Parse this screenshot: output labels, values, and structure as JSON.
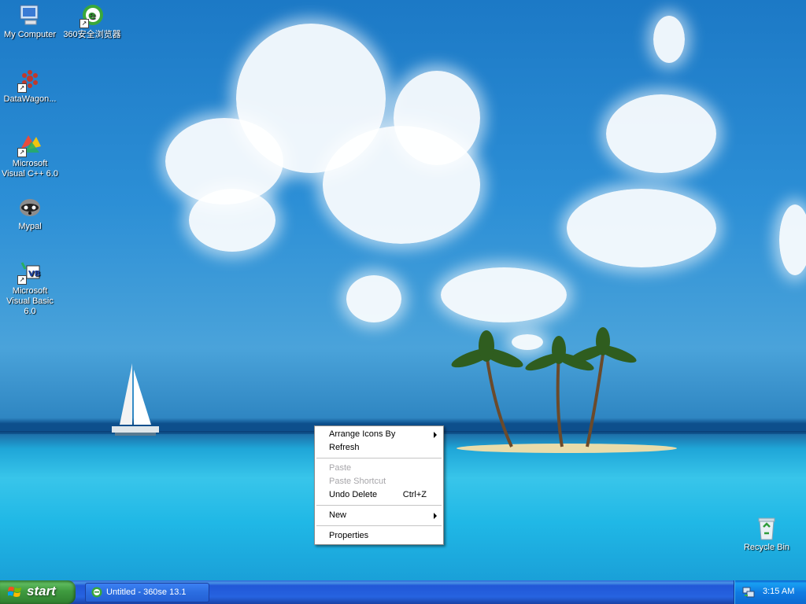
{
  "desktop": {
    "icons": [
      {
        "label": "My Computer",
        "icon": "my-computer-icon"
      },
      {
        "label": "360安全浏览器",
        "icon": "360se-browser-icon"
      },
      {
        "label": "DataWagon...",
        "icon": "datawagon-icon"
      },
      {
        "label": "Microsoft Visual C++ 6.0",
        "icon": "visual-cpp-icon"
      },
      {
        "label": "Mypal",
        "icon": "mypal-raccoon-icon"
      },
      {
        "label": "Microsoft Visual Basic 6.0",
        "icon": "visual-basic-icon"
      },
      {
        "label": "Recycle Bin",
        "icon": "recycle-bin-icon"
      }
    ]
  },
  "context_menu": {
    "items": [
      {
        "label": "Arrange Icons By",
        "submenu": true,
        "enabled": true
      },
      {
        "label": "Refresh",
        "enabled": true
      },
      {
        "label": "Paste",
        "enabled": false
      },
      {
        "label": "Paste Shortcut",
        "enabled": false
      },
      {
        "label": "Undo Delete",
        "accelerator": "Ctrl+Z",
        "enabled": true
      },
      {
        "label": "New",
        "submenu": true,
        "enabled": true
      },
      {
        "label": "Properties",
        "enabled": true
      }
    ]
  },
  "taskbar": {
    "start_label": "start",
    "tasks": [
      {
        "label": "Untitled - 360se 13.1",
        "icon": "360se-browser-icon"
      }
    ],
    "tray": {
      "clock": "3:15 AM",
      "icon": "network-icon"
    }
  },
  "colors": {
    "taskbar": "#2663e0",
    "start_button": "#3f9b3f",
    "tray": "#0f7ce3",
    "sky": "#2c8fd6",
    "sea": "#38c5ea"
  }
}
